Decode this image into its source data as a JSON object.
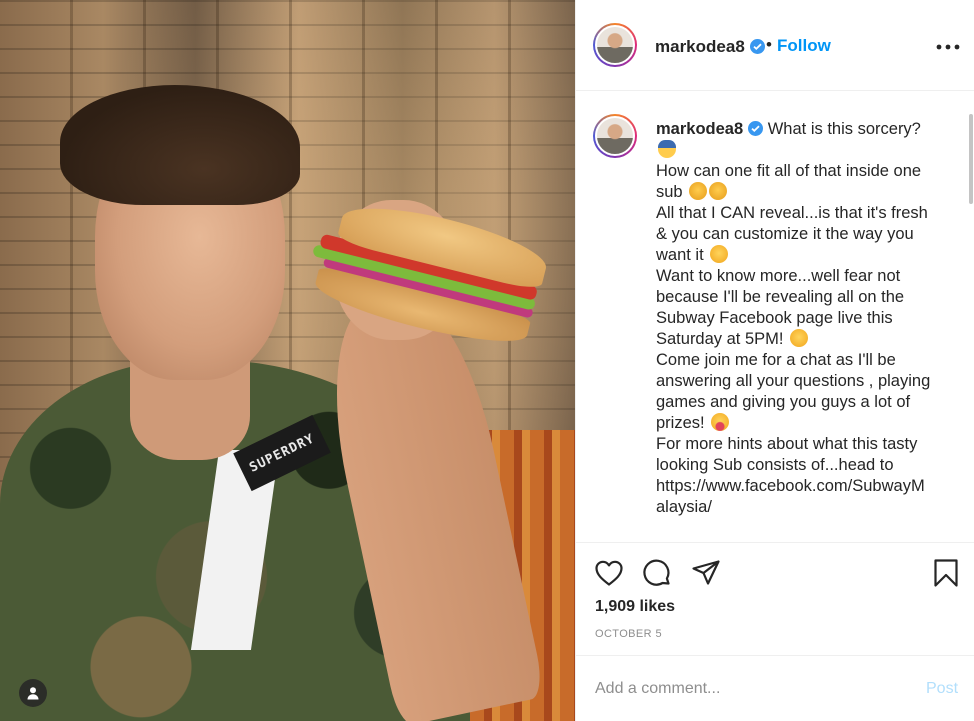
{
  "post": {
    "username": "markodea8",
    "verified": true,
    "follow_dot": "•",
    "follow_label": "Follow",
    "more_icon": "more-options-icon",
    "image_text": "SUPERDRY",
    "caption": {
      "lines": [
        "What is this sorcery?",
        "How can one fit all of that inside one",
        "sub",
        "All that I CAN reveal...is that it's fresh",
        "& you can customize it the way you",
        "want it",
        "Want to know more...well fear not",
        "because I'll be revealing all on the",
        "Subway Facebook page live this",
        "Saturday at 5PM!",
        "Come join me for a chat as I'll be",
        "answering all your questions , playing",
        "games and giving you guys a lot of",
        "prizes!",
        "For more hints about what this tasty",
        "looking Sub consists of...head to",
        "https://www.facebook.com/SubwayM",
        "alaysia/"
      ]
    },
    "likes": "1,909 likes",
    "date": "OCTOBER 5",
    "comment": {
      "placeholder": "Add a comment...",
      "post_label": "Post"
    },
    "colors": {
      "accent": "#0095f6",
      "text": "#262626",
      "muted": "#8e8e8e",
      "post_disabled": "#b2dffc",
      "verified": "#3897f0"
    }
  }
}
